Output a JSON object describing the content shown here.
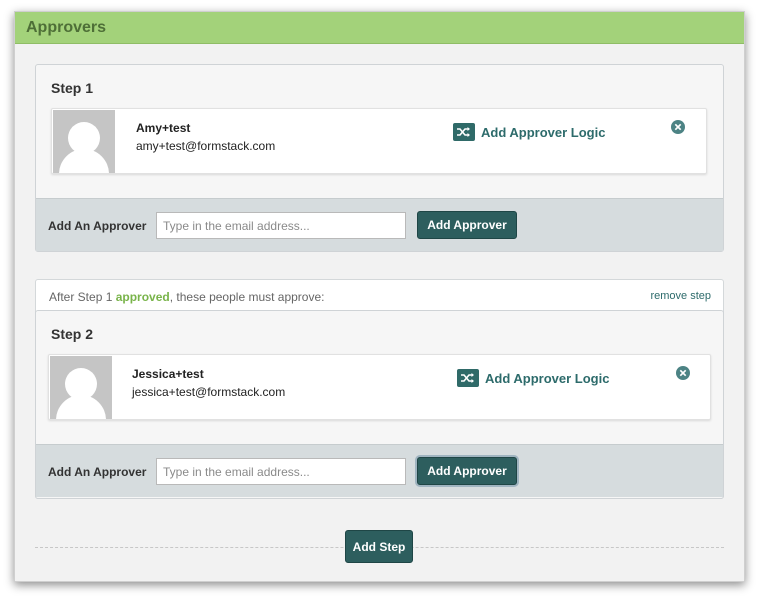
{
  "header": {
    "title": "Approvers"
  },
  "icons": {
    "logic": "shuffle-icon",
    "remove": "close-circle-icon",
    "avatar": "user-silhouette-icon"
  },
  "colors": {
    "header": "#a3d27a",
    "accent": "#2d5e5e",
    "approved": "#79b44a"
  },
  "steps": [
    {
      "title": "Step 1",
      "approver": {
        "name": "Amy+test",
        "email": "amy+test@formstack.com"
      },
      "logic_label": "Add Approver Logic",
      "add_label": "Add An Approver",
      "input_placeholder": "Type in the email address...",
      "input_value": "",
      "add_button": "Add Approver"
    },
    {
      "condition": {
        "prefix": "After Step 1 ",
        "status": "approved",
        "suffix": ", these people must approve:"
      },
      "remove_step": "remove step",
      "title": "Step 2",
      "approver": {
        "name": "Jessica+test",
        "email": "jessica+test@formstack.com"
      },
      "logic_label": "Add Approver Logic",
      "add_label": "Add An Approver",
      "input_placeholder": "Type in the email address...",
      "input_value": "",
      "add_button": "Add Approver"
    }
  ],
  "add_step_button": "Add Step"
}
